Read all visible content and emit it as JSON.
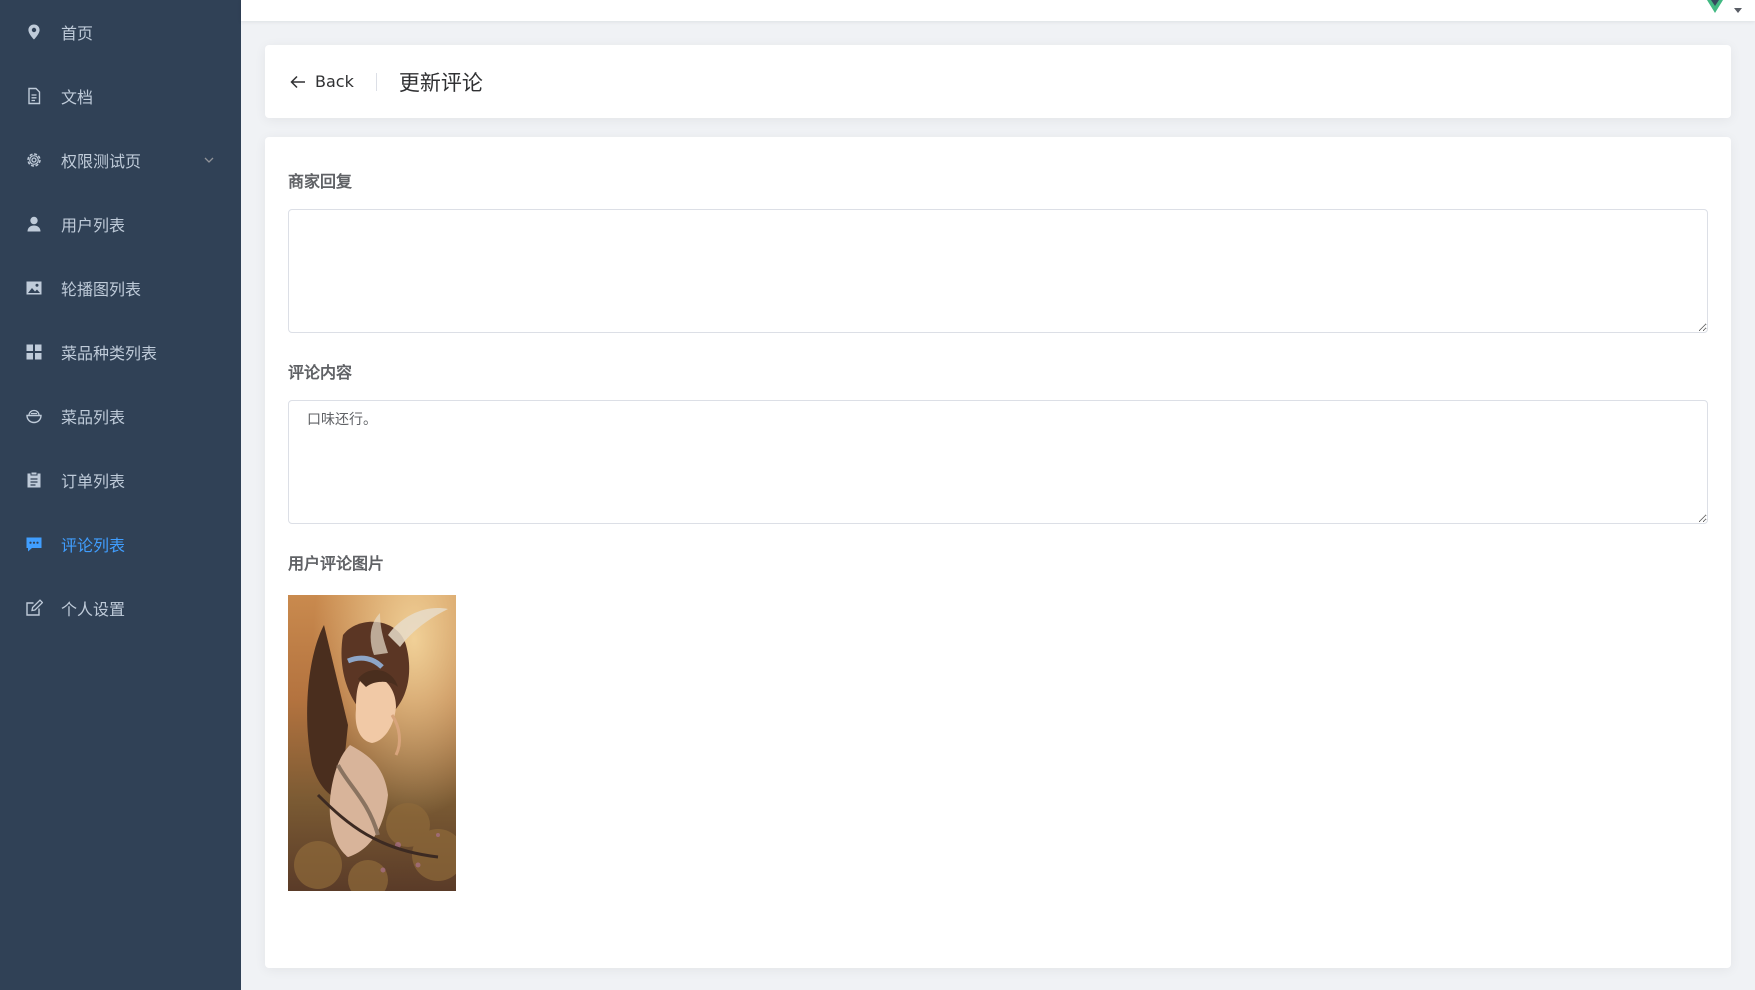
{
  "sidebar": {
    "items": [
      {
        "label": "首页",
        "icon": "location-icon"
      },
      {
        "label": "文档",
        "icon": "document-icon"
      },
      {
        "label": "权限测试页",
        "icon": "gear-icon",
        "has_submenu": true
      },
      {
        "label": "用户列表",
        "icon": "user-icon"
      },
      {
        "label": "轮播图列表",
        "icon": "picture-icon"
      },
      {
        "label": "菜品种类列表",
        "icon": "grid-icon"
      },
      {
        "label": "菜品列表",
        "icon": "bowl-icon"
      },
      {
        "label": "订单列表",
        "icon": "clipboard-icon"
      },
      {
        "label": "评论列表",
        "icon": "chat-icon",
        "active": true
      },
      {
        "label": "个人设置",
        "icon": "edit-icon"
      }
    ]
  },
  "header": {
    "back_label": "Back",
    "title": "更新评论"
  },
  "form": {
    "reply_label": "商家回复",
    "reply_value": "",
    "content_label": "评论内容",
    "content_value": "口味还行。",
    "images_label": "用户评论图片"
  },
  "colors": {
    "sidebar_bg": "#304156",
    "sidebar_text": "#bfcbd9",
    "active": "#409eff",
    "logo": "#42b983"
  }
}
